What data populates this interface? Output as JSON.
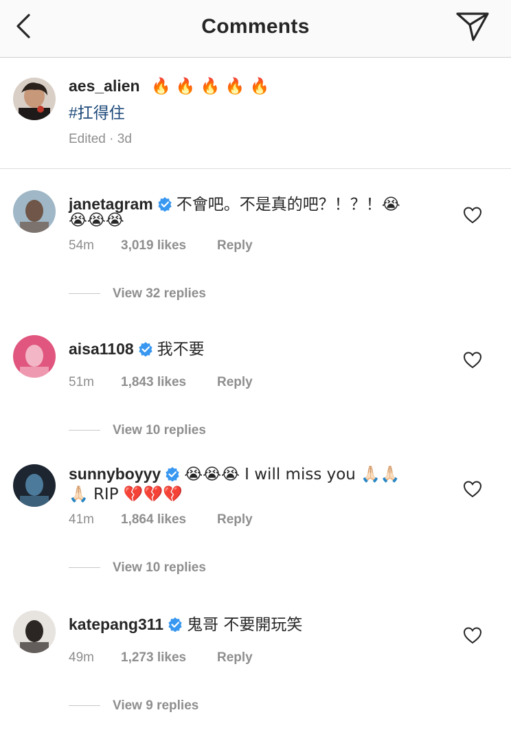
{
  "header": {
    "title": "Comments"
  },
  "caption": {
    "username": "aes_alien",
    "emoji": "🔥 🔥 🔥 🔥 🔥",
    "hashtag": "#扛得住",
    "meta": "Edited · 3d"
  },
  "comments": [
    {
      "username": "janetagram",
      "verified": true,
      "line1": "不會吧。不是真的吧？！？！😭",
      "line2": "😭😭😭",
      "time": "54m",
      "likes": "3,019 likes",
      "reply": "Reply",
      "view_replies": "View 32 replies"
    },
    {
      "username": "aisa1108",
      "verified": true,
      "line1": "我不要",
      "line2": "",
      "time": "51m",
      "likes": "1,843 likes",
      "reply": "Reply",
      "view_replies": "View 10 replies"
    },
    {
      "username": "sunnyboyyy",
      "verified": true,
      "line1": "😭😭😭 I will miss you 🙏🏻🙏🏻",
      "line2": "🙏🏻 RIP 💔💔💔",
      "time": "41m",
      "likes": "1,864 likes",
      "reply": "Reply",
      "view_replies": "View 10 replies"
    },
    {
      "username": "katepang311",
      "verified": true,
      "line1": "鬼哥 不要開玩笑",
      "line2": "",
      "time": "49m",
      "likes": "1,273 likes",
      "reply": "Reply",
      "view_replies": "View 9 replies"
    }
  ],
  "colors": {
    "verified_badge": "#3897f0",
    "hashtag": "#1e4a7a",
    "meta_gray": "#8e8e8e"
  }
}
